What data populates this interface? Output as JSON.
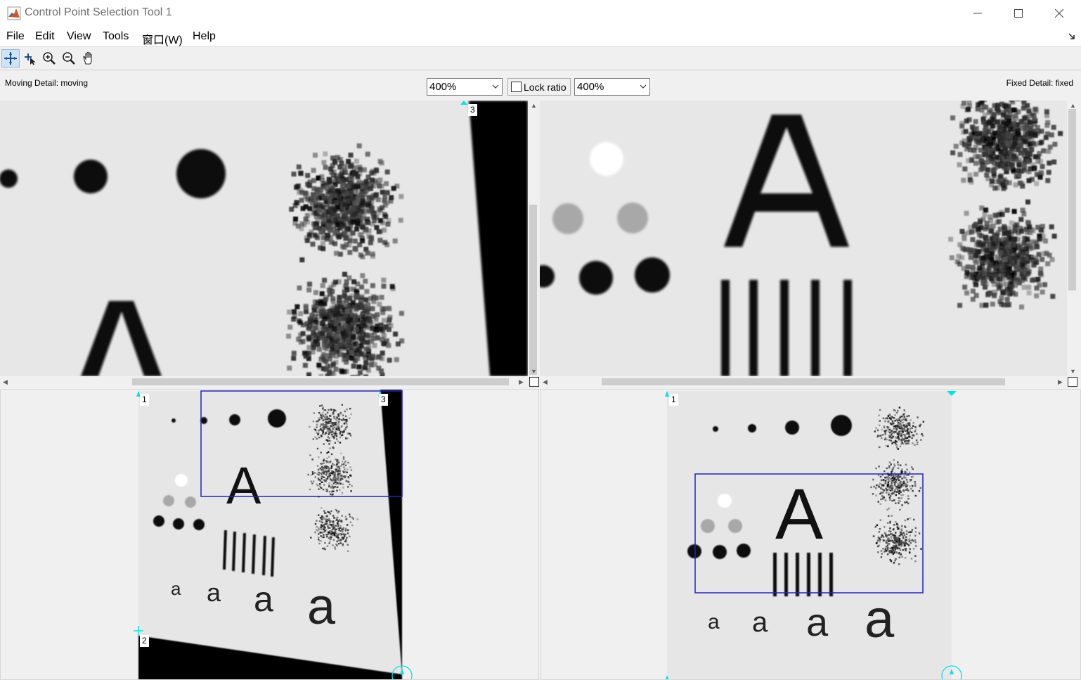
{
  "window": {
    "title": "Control Point Selection Tool 1"
  },
  "menu": {
    "file": "File",
    "edit": "Edit",
    "view": "View",
    "tools": "Tools",
    "window": "窗口(W)",
    "help": "Help"
  },
  "toolbar": {
    "tools": [
      "add-point-icon",
      "select-point-icon",
      "zoom-in-icon",
      "zoom-out-icon",
      "pan-hand-icon"
    ],
    "active_tool": "add-point-icon"
  },
  "detail_header": {
    "moving_label": "Moving Detail: moving",
    "fixed_label": "Fixed Detail: fixed",
    "moving_zoom": "400%",
    "fixed_zoom": "400%",
    "lock_ratio_label": "Lock ratio",
    "lock_ratio_checked": false
  },
  "control_points": {
    "detail_moving": [
      "3"
    ],
    "overview_moving": [
      "1",
      "3",
      "2"
    ],
    "overview_fixed": [
      "1"
    ]
  },
  "overview_glyphs": {
    "big_letter": "A",
    "small_letter": "a"
  },
  "colors": {
    "accent": "#00e5e5",
    "detail_rect": "#2222bb",
    "image_bg": "#e6e6e6"
  }
}
